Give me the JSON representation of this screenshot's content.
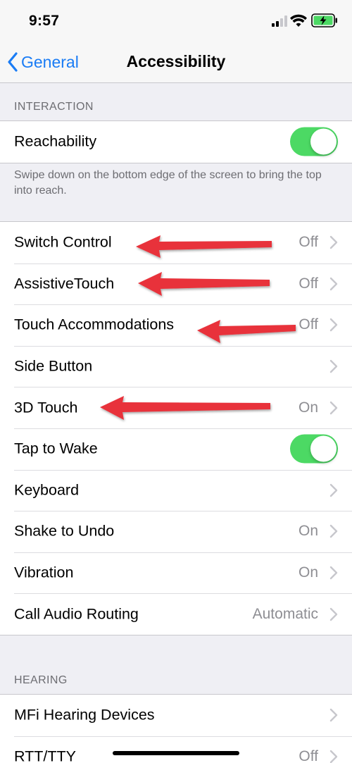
{
  "status": {
    "time": "9:57"
  },
  "nav": {
    "back_label": "General",
    "title": "Accessibility"
  },
  "sections": [
    {
      "header": "INTERACTION",
      "rows": [
        {
          "label": "Reachability",
          "control": "toggle",
          "state": "on"
        }
      ],
      "footer": "Swipe down on the bottom edge of the screen to bring the top into reach."
    },
    {
      "rows": [
        {
          "label": "Switch Control",
          "value": "Off",
          "control": "chevron"
        },
        {
          "label": "AssistiveTouch",
          "value": "Off",
          "control": "chevron"
        },
        {
          "label": "Touch Accommodations",
          "value": "Off",
          "control": "chevron"
        },
        {
          "label": "Side Button",
          "value": "",
          "control": "chevron"
        },
        {
          "label": "3D Touch",
          "value": "On",
          "control": "chevron"
        },
        {
          "label": "Tap to Wake",
          "control": "toggle",
          "state": "on"
        },
        {
          "label": "Keyboard",
          "value": "",
          "control": "chevron"
        },
        {
          "label": "Shake to Undo",
          "value": "On",
          "control": "chevron"
        },
        {
          "label": "Vibration",
          "value": "On",
          "control": "chevron"
        },
        {
          "label": "Call Audio Routing",
          "value": "Automatic",
          "control": "chevron"
        }
      ]
    },
    {
      "header": "HEARING",
      "rows": [
        {
          "label": "MFi Hearing Devices",
          "value": "",
          "control": "chevron"
        },
        {
          "label": "RTT/TTY",
          "value": "Off",
          "control": "chevron"
        }
      ]
    }
  ],
  "colors": {
    "accent": "#1a7cf5",
    "toggle_on": "#4cd964",
    "annotation_arrow": "#e8303a",
    "background": "#efeff4"
  }
}
